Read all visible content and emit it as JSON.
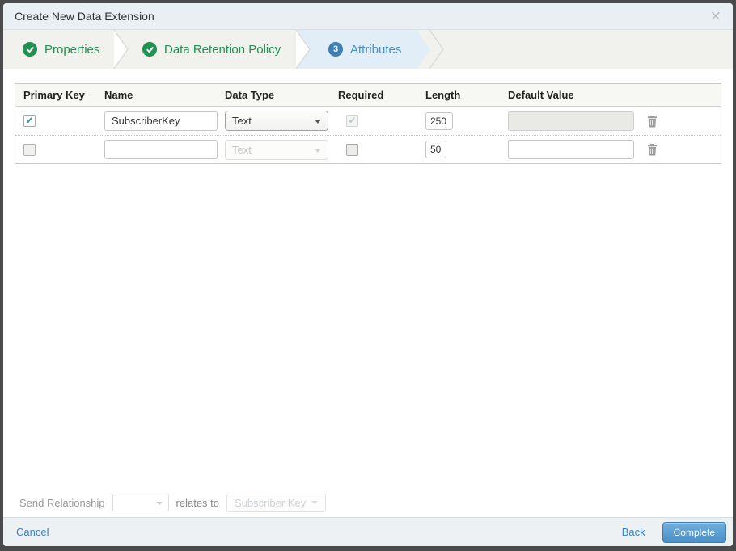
{
  "modal": {
    "title": "Create New Data Extension",
    "close_icon": "×"
  },
  "wizard": {
    "steps": [
      {
        "label": "Properties",
        "state": "complete"
      },
      {
        "label": "Data Retention Policy",
        "state": "complete"
      },
      {
        "label": "Attributes",
        "state": "active",
        "number": "3"
      }
    ]
  },
  "attributes_table": {
    "headers": {
      "primary_key": "Primary Key",
      "name": "Name",
      "data_type": "Data Type",
      "required": "Required",
      "length": "Length",
      "default_value": "Default Value"
    },
    "rows": [
      {
        "primary_key_checked": true,
        "name": "SubscriberKey",
        "data_type": "Text",
        "data_type_disabled": false,
        "required_checked": true,
        "required_disabled": true,
        "length": "250",
        "default_value": "",
        "default_value_disabled": true
      },
      {
        "primary_key_checked": false,
        "name": "",
        "data_type": "Text",
        "data_type_disabled": true,
        "required_checked": false,
        "required_disabled": false,
        "length": "50",
        "default_value": "",
        "default_value_disabled": false
      }
    ]
  },
  "send_relationship": {
    "label": "Send Relationship",
    "connector": "relates to",
    "target": "Subscriber Key"
  },
  "footer": {
    "cancel": "Cancel",
    "back": "Back",
    "complete": "Complete"
  },
  "colors": {
    "success_green": "#1f9151",
    "active_blue": "#4a90c4",
    "button_blue_top": "#6fb0df",
    "button_blue_bottom": "#4a8fc9"
  }
}
